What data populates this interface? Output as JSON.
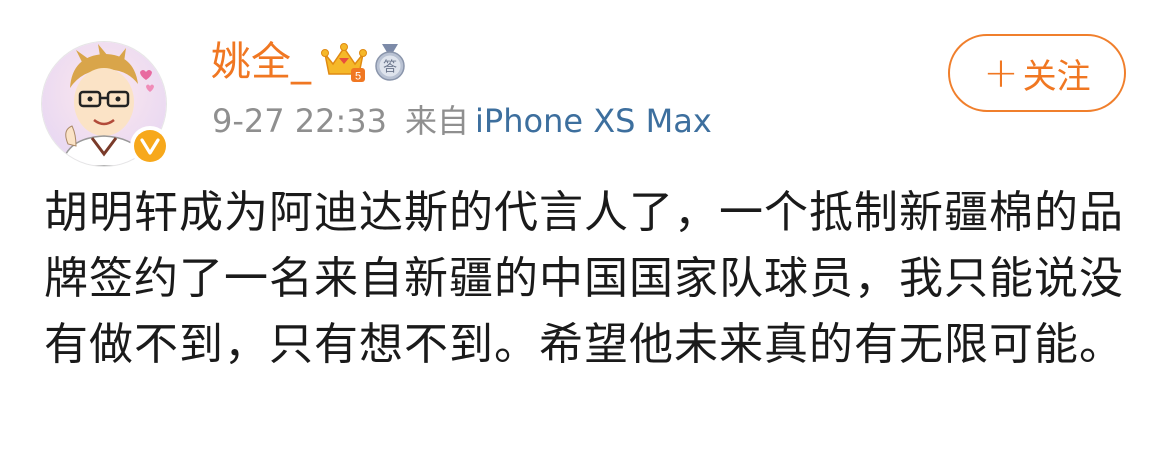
{
  "user": {
    "name": "姚全_",
    "avatar_icon": "cartoon-portrait-avatar",
    "verified_icon": "verified-v-badge",
    "crown_icon": "vip-crown-icon",
    "crown_level": "5",
    "medal_icon": "answer-medal-icon",
    "medal_label": "答"
  },
  "meta": {
    "time": "9-27 22:33",
    "from_label": "来自",
    "device": "iPhone XS Max"
  },
  "follow_button": {
    "plus": "+",
    "label": "关注"
  },
  "post": {
    "text": "胡明轩成为阿迪达斯的代言人了，一个抵制新疆棉的品牌签约了一名来自新疆的中国国家队球员，我只能说没有做不到，只有想不到。希望他未来真的有无限可能。"
  },
  "colors": {
    "username": "#f07722",
    "device_link": "#3d6f9e",
    "meta": "#8f8f8f",
    "text": "#1a1a1a",
    "follow_border": "#f07f2c",
    "verified": "#f7a81b"
  }
}
